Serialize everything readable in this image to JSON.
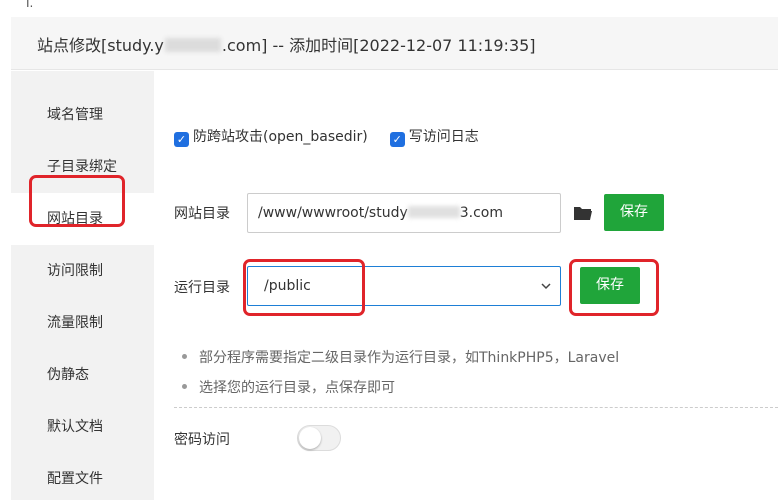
{
  "window": {
    "title_prefix": "站点修改[study.y",
    "title_suffix": ".com] -- 添加时间[2022-12-07 11:19:35]"
  },
  "sidebar": {
    "items": [
      {
        "label": "域名管理"
      },
      {
        "label": "子目录绑定"
      },
      {
        "label": "网站目录",
        "active": true
      },
      {
        "label": "访问限制"
      },
      {
        "label": "流量限制"
      },
      {
        "label": "伪静态"
      },
      {
        "label": "默认文档"
      },
      {
        "label": "配置文件"
      }
    ]
  },
  "options": {
    "anti_xss": {
      "label": "防跨站攻击(open_basedir)",
      "checked": true
    },
    "access_log": {
      "label": "写访问日志",
      "checked": true
    }
  },
  "site_dir": {
    "label": "网站目录",
    "value_prefix": "/www/wwwroot/study",
    "value_suffix": "3.com",
    "save_label": "保存"
  },
  "run_dir": {
    "label": "运行目录",
    "selected": "/public",
    "save_label": "保存"
  },
  "tips": [
    "部分程序需要指定二级目录作为运行目录，如ThinkPHP5，Laravel",
    "选择您的运行目录，点保存即可"
  ],
  "password_access": {
    "label": "密码访问",
    "enabled": false
  },
  "colors": {
    "accent_green": "#20a53a",
    "checkbox_blue": "#1f6fe0",
    "highlight_red": "#e0242a"
  },
  "icons": [
    "check-icon",
    "folder-icon",
    "chevron-down-icon"
  ]
}
